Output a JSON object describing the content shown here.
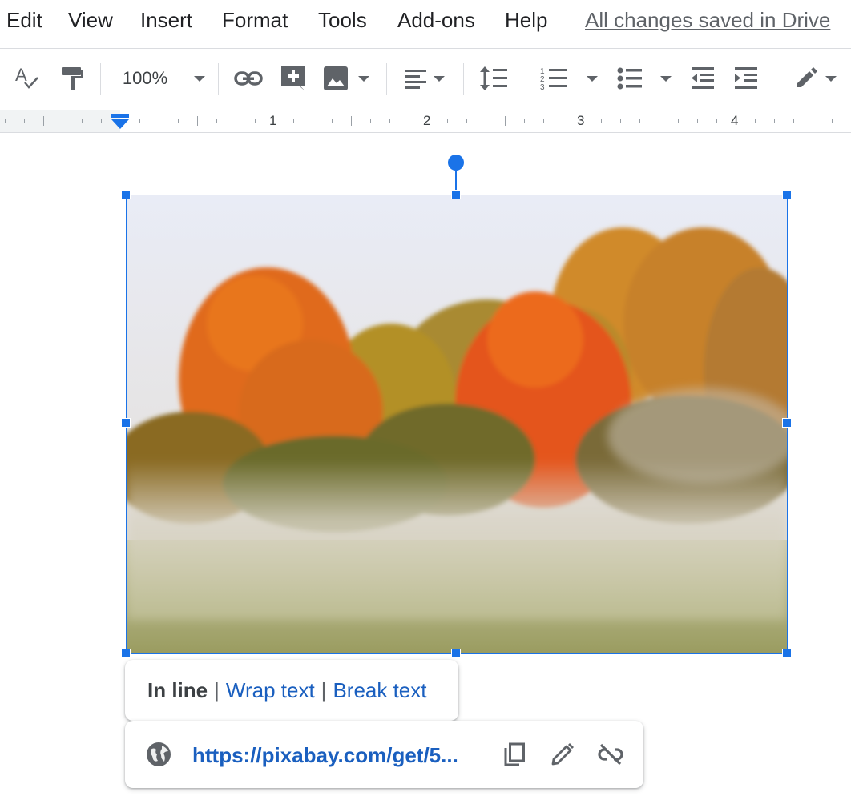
{
  "menu": {
    "items": [
      "Edit",
      "View",
      "Insert",
      "Format",
      "Tools",
      "Add-ons",
      "Help"
    ],
    "save_status": "All changes saved in Drive"
  },
  "toolbar": {
    "zoom": "100%",
    "icons": [
      "spellcheck-icon",
      "paint-format-icon",
      "link-icon",
      "add-comment-icon",
      "image-icon",
      "align-icon",
      "line-spacing-icon",
      "numbered-list-icon",
      "bulleted-list-icon",
      "decrease-indent-icon",
      "increase-indent-icon",
      "editing-mode-icon"
    ]
  },
  "ruler": {
    "numbers": [
      "1",
      "2",
      "3",
      "4"
    ]
  },
  "image_options": {
    "in_line": "In line",
    "separator": "|",
    "wrap_text": "Wrap text",
    "break_text": "Break text"
  },
  "link_popup": {
    "url": "https://pixabay.com/get/5..."
  },
  "colors": {
    "accent": "#1a73e8",
    "link": "#1a5fbf"
  }
}
